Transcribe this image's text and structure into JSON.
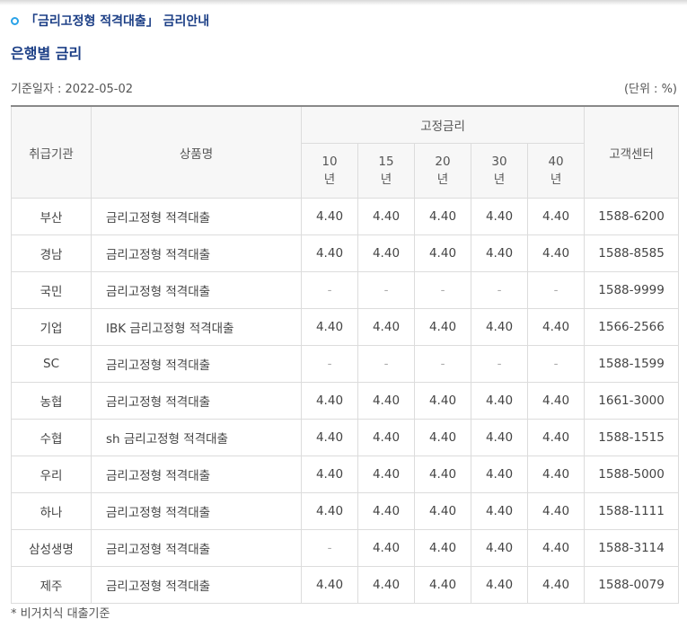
{
  "section_title": "「금리고정형 적격대출」 금리안내",
  "sub_title": "은행별 금리",
  "base_date": "기준일자 : 2022-05-02",
  "unit": "(단위 : %)",
  "table": {
    "headers": {
      "institution": "취급기관",
      "product": "상품명",
      "fixed_rate": "고정금리",
      "terms": [
        {
          "num": "10",
          "unit": "년"
        },
        {
          "num": "15",
          "unit": "년"
        },
        {
          "num": "20",
          "unit": "년"
        },
        {
          "num": "30",
          "unit": "년"
        },
        {
          "num": "40",
          "unit": "년"
        }
      ],
      "center": "고객센터"
    },
    "rows": [
      {
        "institution": "부산",
        "product": "금리고정형 적격대출",
        "rates": [
          "4.40",
          "4.40",
          "4.40",
          "4.40",
          "4.40"
        ],
        "phone": "1588-6200"
      },
      {
        "institution": "경남",
        "product": "금리고정형 적격대출",
        "rates": [
          "4.40",
          "4.40",
          "4.40",
          "4.40",
          "4.40"
        ],
        "phone": "1588-8585"
      },
      {
        "institution": "국민",
        "product": "금리고정형 적격대출",
        "rates": [
          "-",
          "-",
          "-",
          "-",
          "-"
        ],
        "phone": "1588-9999"
      },
      {
        "institution": "기업",
        "product": "IBK 금리고정형 적격대출",
        "rates": [
          "4.40",
          "4.40",
          "4.40",
          "4.40",
          "4.40"
        ],
        "phone": "1566-2566"
      },
      {
        "institution": "SC",
        "product": "금리고정형 적격대출",
        "rates": [
          "-",
          "-",
          "-",
          "-",
          "-"
        ],
        "phone": "1588-1599"
      },
      {
        "institution": "농협",
        "product": "금리고정형 적격대출",
        "rates": [
          "4.40",
          "4.40",
          "4.40",
          "4.40",
          "4.40"
        ],
        "phone": "1661-3000"
      },
      {
        "institution": "수협",
        "product": "sh 금리고정형 적격대출",
        "rates": [
          "4.40",
          "4.40",
          "4.40",
          "4.40",
          "4.40"
        ],
        "phone": "1588-1515"
      },
      {
        "institution": "우리",
        "product": "금리고정형 적격대출",
        "rates": [
          "4.40",
          "4.40",
          "4.40",
          "4.40",
          "4.40"
        ],
        "phone": "1588-5000"
      },
      {
        "institution": "하나",
        "product": "금리고정형 적격대출",
        "rates": [
          "4.40",
          "4.40",
          "4.40",
          "4.40",
          "4.40"
        ],
        "phone": "1588-1111"
      },
      {
        "institution": "삼성생명",
        "product": "금리고정형 적격대출",
        "rates": [
          "-",
          "4.40",
          "4.40",
          "4.40",
          "4.40"
        ],
        "phone": "1588-3114"
      },
      {
        "institution": "제주",
        "product": "금리고정형 적격대출",
        "rates": [
          "4.40",
          "4.40",
          "4.40",
          "4.40",
          "4.40"
        ],
        "phone": "1588-0079"
      }
    ]
  },
  "footnote": "* 비거치식 대출기준",
  "colors": {
    "title": "#1c3f86",
    "bullet": "#2aa3e8",
    "header_bg": "#f7f7f7",
    "border": "#dcdcdc"
  },
  "icons": {
    "bullet": "circle-bullet-icon"
  }
}
